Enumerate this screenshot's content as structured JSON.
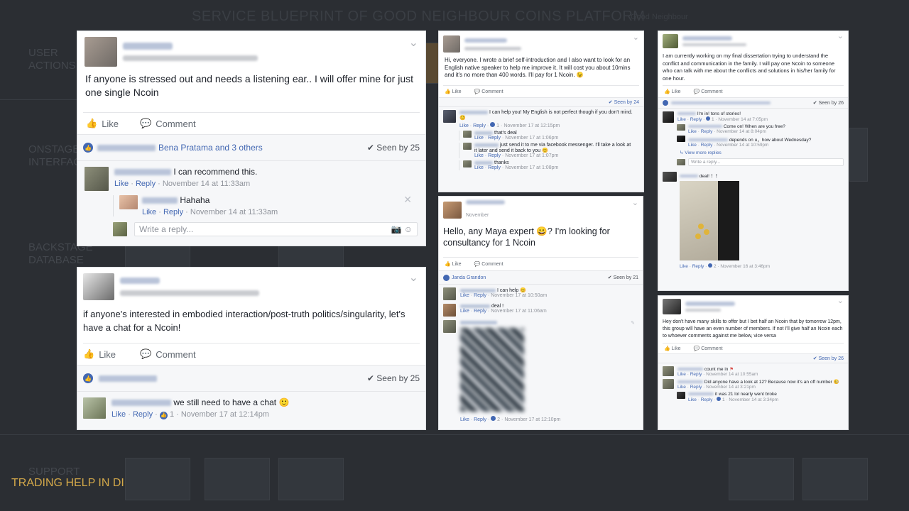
{
  "slide": {
    "title": "SERVICE BLUEPRINT OF GOOD NEIGHBOUR COINS PLATFORM",
    "subtitle": "Good Neighbour",
    "rows": [
      "USER ACTIONS",
      "ONSTAGE INTERFACE",
      "BACKSTAGE DATABASE",
      "SUPPORT"
    ],
    "footer": "TRADING HELP IN DI"
  },
  "posts": {
    "p1": {
      "body": "If anyone is stressed out and needs a listening ear.. I will offer mine for just one single Ncoin",
      "like": "Like",
      "comment": "Comment",
      "reactors_tail": "Bena Pratama and 3 others",
      "seen": "Seen by 25",
      "c1": {
        "text": "I can recommend this.",
        "meta_like": "Like",
        "meta_reply": "Reply",
        "time": "November 14 at 11:33am"
      },
      "c2": {
        "name": "Hahaha",
        "meta_like": "Like",
        "meta_reply": "Reply",
        "time": "November 14 at 11:33am"
      },
      "placeholder": "Write a reply..."
    },
    "p2": {
      "body": "if anyone's interested in embodied interaction/post-truth politics/singularity, let's have a chat for a Ncoin!",
      "like": "Like",
      "comment": "Comment",
      "seen": "Seen by 25",
      "c1": {
        "text": "we still need to have a chat",
        "meta_like": "Like",
        "meta_reply": "Reply",
        "count": "1",
        "time": "November 17 at 12:14pm"
      }
    },
    "p3": {
      "body": "Hi, everyone. I wrote a brief self-introduction and I also want to look for an English native speaker to help me improve it. It will cost you about 10mins and it's no more than 400 words. I'll pay for 1 Ncoin.",
      "like": "Like",
      "comment": "Comment",
      "seen": "Seen by 24",
      "c1": {
        "text": "I can help you! My English is not perfect though if you don't mind.",
        "meta_like": "Like",
        "meta_reply": "Reply",
        "count": "1",
        "time": "November 17 at 12:15pm"
      },
      "c2": {
        "text": "that's deal",
        "meta_like": "Like",
        "meta_reply": "Reply",
        "time": "November 17 at 1:06pm"
      },
      "c3": {
        "text": "just send it to me via facebook messenger. I'll take a look at it later and send it back to you",
        "meta_like": "Like",
        "meta_reply": "Reply",
        "time": "November 17 at 1:07pm"
      },
      "c4": {
        "text": "thanks",
        "meta_like": "Like",
        "meta_reply": "Reply",
        "time": "November 17 at 1:08pm"
      }
    },
    "p4": {
      "date": "November",
      "body": "Hello, any Maya expert",
      "body2": "? I'm looking for consultancy for 1 Ncoin",
      "like": "Like",
      "comment": "Comment",
      "reactor": "Janda Grandon",
      "seen": "Seen by 21",
      "c1": {
        "text": "I can help",
        "meta_like": "Like",
        "meta_reply": "Reply",
        "time": "November 17 at 10:50am"
      },
      "c2": {
        "text": "deal !",
        "meta_like": "Like",
        "meta_reply": "Reply",
        "time": "November 17 at 11:06am"
      },
      "c3": {
        "meta_like": "Like",
        "meta_reply": "Reply",
        "count": "2",
        "time": "November 17 at 12:10pm"
      }
    },
    "p5": {
      "body": "I am currently working on my final dissertation trying to understand the conflict and communication in the family. I will pay one Ncoin to someone who can talk with me about the conflicts and solutions in his/her family for one hour.",
      "like": "Like",
      "comment": "Comment",
      "seen": "Seen by 26",
      "c1": {
        "text": "I'm in! tons of stories!",
        "meta_like": "Like",
        "meta_reply": "Reply",
        "count": "1",
        "time": "November 14 at 7:05pm"
      },
      "c2": {
        "text": "Come on! When are you free?",
        "meta_like": "Like",
        "meta_reply": "Reply",
        "time": "November 14 at 8:04pm"
      },
      "c3": {
        "text": "depends on u，how about Wednesday?",
        "meta_like": "Like",
        "meta_reply": "Reply",
        "time": "November 14 at 10:59pm"
      },
      "more": "View more replies",
      "placeholder": "Write a reply...",
      "c4": {
        "text": "deal! ！！",
        "meta_like": "Like",
        "meta_reply": "Reply",
        "count": "2",
        "time": "November 16 at 3:46pm"
      }
    },
    "p6": {
      "body": "Hey don't have many skills to offer but I bet half an Ncoin that by tomorrow 12pm, this group will have an even number of members. If not I'll give half an Ncoin each to whoever comments against me below, vice versa",
      "like": "Like",
      "comment": "Comment",
      "seen": "Seen by 26",
      "c1": {
        "text": "count me in",
        "meta_like": "Like",
        "meta_reply": "Reply",
        "time": "November 14 at 10:55am"
      },
      "c2": {
        "text": "Did anyone have a look at 12? Because now it's an off number",
        "meta_like": "Like",
        "meta_reply": "Reply",
        "time": "November 14 at 3:21pm"
      },
      "c3": {
        "text": "it was 21 lol nearly went broke",
        "meta_like": "Like",
        "meta_reply": "Reply",
        "count": "1",
        "time": "November 14 at 3:34pm"
      }
    }
  }
}
